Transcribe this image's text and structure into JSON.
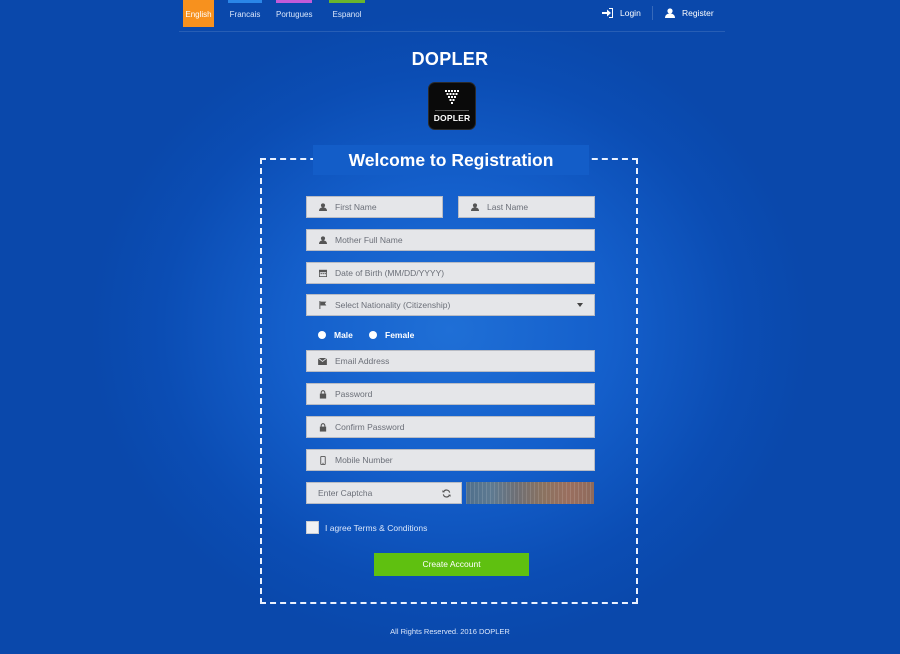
{
  "languages": [
    {
      "label": "English",
      "active": true,
      "color": "#f7911e"
    },
    {
      "label": "Francais",
      "active": false,
      "color": "#2a86e8"
    },
    {
      "label": "Portugues",
      "active": false,
      "color": "#c25bd8"
    },
    {
      "label": "Espanol",
      "active": false,
      "color": "#69b52e"
    }
  ],
  "header": {
    "login": "Login",
    "register": "Register"
  },
  "brand": {
    "title": "DOPLER",
    "logo_text": "DOPLER"
  },
  "form": {
    "title": "Welcome to Registration",
    "first_name": "First Name",
    "last_name": "Last Name",
    "mother_name": "Mother Full Name",
    "dob": "Date of Birth (MM/DD/YYYY)",
    "nationality": "Select Nationality (Citizenship)",
    "male": "Male",
    "female": "Female",
    "email": "Email Address",
    "password": "Password",
    "confirm_password": "Confirm Password",
    "mobile": "Mobile Number",
    "captcha": "Enter Captcha",
    "agree": "I agree Terms & Conditions",
    "submit": "Create Account"
  },
  "footer": "All Rights Reserved. 2016 DOPLER",
  "colors": {
    "accent": "#f7911e",
    "button": "#5fc010",
    "background": "#145fcb"
  }
}
